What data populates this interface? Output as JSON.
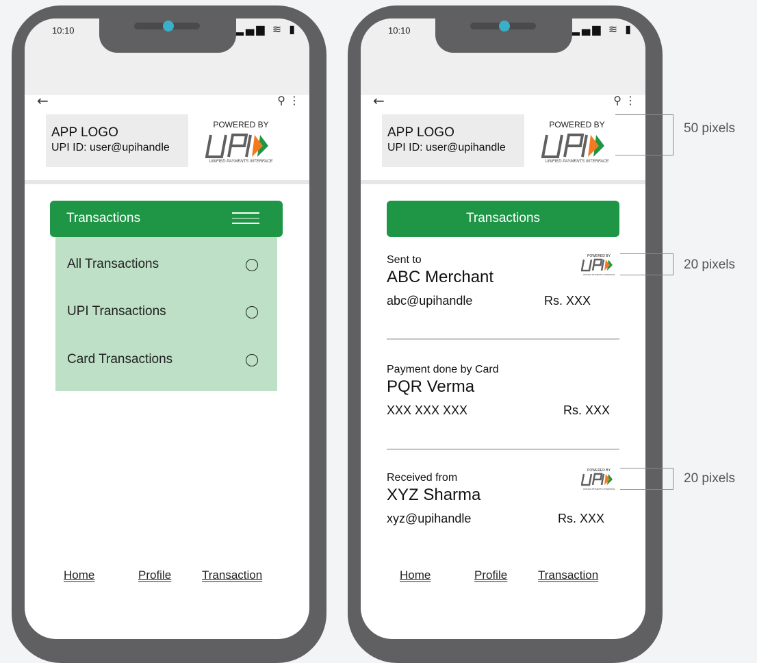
{
  "phone1": {
    "time": "10:10",
    "header": {
      "app_logo": "APP LOGO",
      "upi_id": "UPI ID: user@upihandle",
      "powered_by": "POWERED BY",
      "upi_tagline": "UNIFIED PAYMENTS INTERFACE"
    },
    "transactions_label": "Transactions",
    "menu": [
      {
        "label": "All Transactions"
      },
      {
        "label": "UPI Transactions"
      },
      {
        "label": "Card Transactions"
      }
    ],
    "nav": {
      "home": "Home",
      "profile": "Profile",
      "transaction": "Transaction"
    }
  },
  "phone2": {
    "time": "10:10",
    "header": {
      "app_logo": "APP LOGO",
      "upi_id": "UPI ID: user@upihandle",
      "powered_by": "POWERED BY",
      "upi_tagline": "UNIFIED PAYMENTS INTERFACE"
    },
    "transactions_label": "Transactions",
    "items": [
      {
        "type": "Sent to",
        "name": "ABC Merchant",
        "id": "abc@upihandle",
        "amount": "Rs. XXX"
      },
      {
        "type": "Payment done by Card",
        "name": "PQR Verma",
        "id": "XXX XXX  XXX",
        "amount": "Rs. XXX"
      },
      {
        "type": "Received from",
        "name": "XYZ Sharma",
        "id": "xyz@upihandle",
        "amount": "Rs. XXX"
      }
    ],
    "small_badge": {
      "powered_by": "POWERED BY",
      "tagline": "UNIFIED PAYMENTS INTERFACE"
    },
    "nav": {
      "home": "Home",
      "profile": "Profile",
      "transaction": "Transaction"
    }
  },
  "annotations": {
    "logo_size": "50 pixels",
    "badge_size_1": "20 pixels",
    "badge_size_2": "20 pixels"
  },
  "colors": {
    "brand_green": "#1e9646",
    "menu_bg": "#bde0c6",
    "phone_frame": "#606062",
    "upi_orange": "#f47a20",
    "upi_green": "#1e9646"
  },
  "icons": [
    "back-arrow-icon",
    "search-icon",
    "more-vert-icon",
    "signal-icon",
    "wifi-icon",
    "battery-icon",
    "hamburger-menu-icon",
    "radio-icon"
  ]
}
